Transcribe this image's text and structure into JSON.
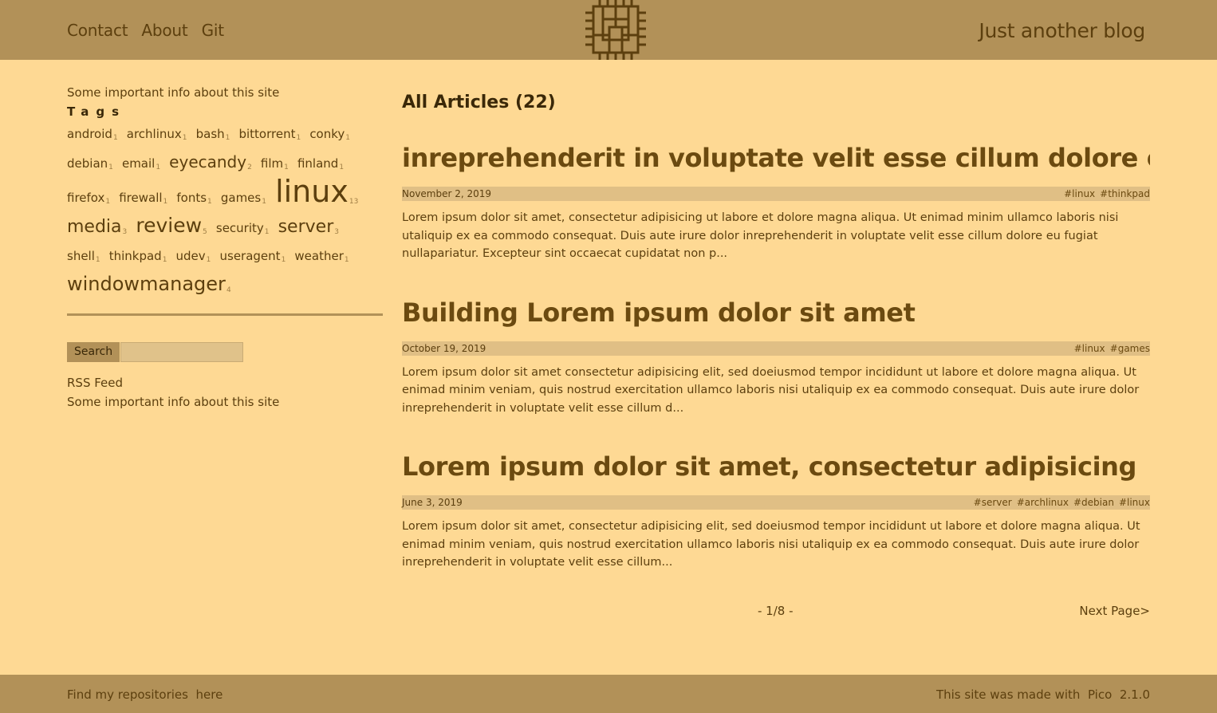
{
  "header": {
    "nav": [
      "Contact",
      "About",
      "Git"
    ],
    "blog_title": "Just another blog",
    "logo_icon": "chip-logo-icon"
  },
  "sidebar": {
    "info_top": "Some important info about this site",
    "tags_heading": "Tags",
    "tags": [
      {
        "name": "android",
        "count": "1",
        "size": 15
      },
      {
        "name": "archlinux",
        "count": "1",
        "size": 15
      },
      {
        "name": "bash",
        "count": "1",
        "size": 15
      },
      {
        "name": "bittorrent",
        "count": "1",
        "size": 15
      },
      {
        "name": "conky",
        "count": "1",
        "size": 15
      },
      {
        "name": "debian",
        "count": "1",
        "size": 15
      },
      {
        "name": "email",
        "count": "1",
        "size": 15
      },
      {
        "name": "eyecandy",
        "count": "2",
        "size": 20
      },
      {
        "name": "film",
        "count": "1",
        "size": 15
      },
      {
        "name": "finland",
        "count": "1",
        "size": 15
      },
      {
        "name": "firefox",
        "count": "1",
        "size": 15
      },
      {
        "name": "firewall",
        "count": "1",
        "size": 15
      },
      {
        "name": "fonts",
        "count": "1",
        "size": 15
      },
      {
        "name": "games",
        "count": "1",
        "size": 15
      },
      {
        "name": "linux",
        "count": "13",
        "size": 38
      },
      {
        "name": "media",
        "count": "3",
        "size": 22
      },
      {
        "name": "review",
        "count": "5",
        "size": 25
      },
      {
        "name": "security",
        "count": "1",
        "size": 15
      },
      {
        "name": "server",
        "count": "3",
        "size": 22
      },
      {
        "name": "shell",
        "count": "1",
        "size": 15
      },
      {
        "name": "thinkpad",
        "count": "1",
        "size": 15
      },
      {
        "name": "udev",
        "count": "1",
        "size": 15
      },
      {
        "name": "useragent",
        "count": "1",
        "size": 15
      },
      {
        "name": "weather",
        "count": "1",
        "size": 15
      },
      {
        "name": "windowmanager",
        "count": "4",
        "size": 24
      }
    ],
    "search_label": "Search",
    "search_value": "",
    "rss_label": "RSS Feed",
    "info_bottom": "Some important info about this site"
  },
  "main": {
    "heading": "All Articles (22)",
    "articles": [
      {
        "title": "inreprehenderit in voluptate velit esse cillum dolore eu fugiat",
        "date": "November 2, 2019",
        "tags": [
          "#linux",
          "#thinkpad"
        ],
        "excerpt": "Lorem ipsum dolor sit amet, consectetur adipisicing ut labore et dolore magna aliqua. Ut enimad minim ullamco laboris nisi utaliquip ex ea commodo consequat. Duis aute irure dolor inreprehenderit in voluptate velit esse cillum dolore eu fugiat nullapariatur. Excepteur sint occaecat cupidatat non p..."
      },
      {
        "title": "Building Lorem ipsum dolor sit amet",
        "date": "October 19, 2019",
        "tags": [
          "#linux",
          "#games"
        ],
        "excerpt": "Lorem ipsum dolor sit amet consectetur adipisicing elit, sed doeiusmod tempor incididunt ut labore et dolore magna aliqua. Ut enimad minim veniam, quis nostrud exercitation ullamco laboris nisi utaliquip ex ea commodo consequat. Duis aute irure dolor inreprehenderit in voluptate velit esse cillum d..."
      },
      {
        "title": "Lorem ipsum dolor sit amet, consectetur adipisicing",
        "date": "June 3, 2019",
        "tags": [
          "#server",
          "#archlinux",
          "#debian",
          "#linux"
        ],
        "excerpt": "Lorem ipsum dolor sit amet, consectetur adipisicing elit, sed doeiusmod tempor incididunt ut labore et dolore magna aliqua. Ut enimad minim veniam, quis nostrud exercitation ullamco laboris nisi utaliquip ex ea commodo consequat. Duis aute irure dolor inreprehenderit in voluptate velit esse cillum..."
      }
    ],
    "pagination": "- 1/8 -",
    "next_label": "Next Page>"
  },
  "footer": {
    "left_text": "Find my repositories",
    "left_link": "here",
    "right_text": "This site was made with",
    "right_link": "Pico",
    "version": "2.1.0"
  },
  "colors": {
    "background": "#fed994",
    "header": "#b29158",
    "meta_bar": "#e0bf85",
    "text": "#5c3f0e"
  }
}
